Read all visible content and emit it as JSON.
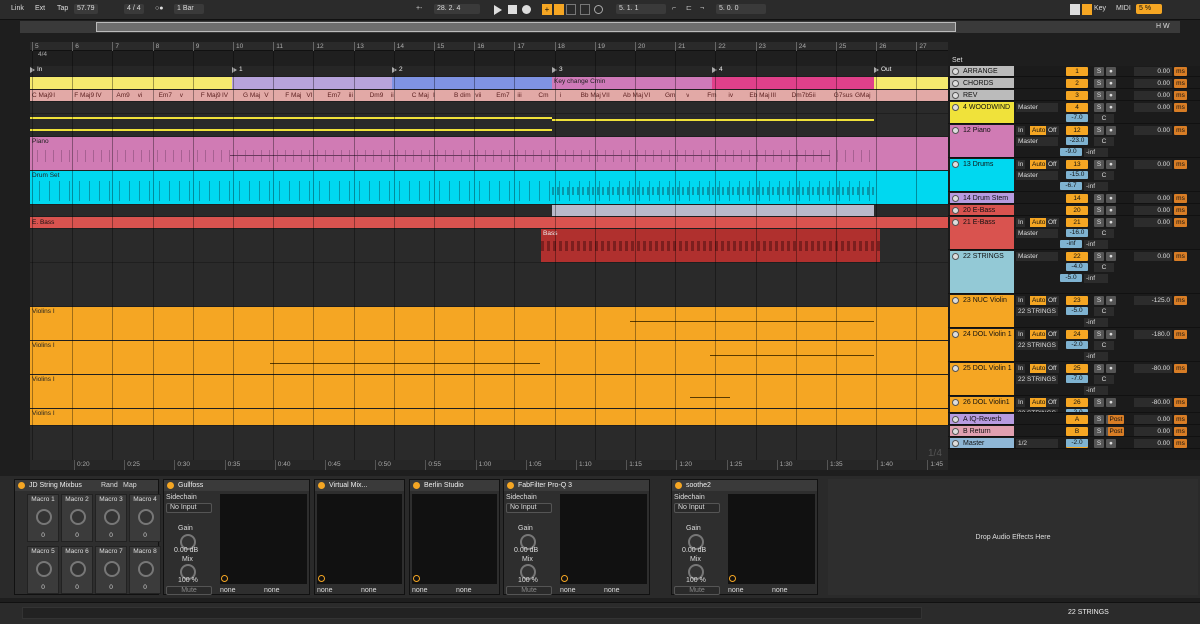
{
  "transport": {
    "link": "Link",
    "ext": "Ext",
    "tap": "Tap",
    "tempo": "57.79",
    "signature": "4 / 4",
    "loop_mode": "○●",
    "quantize": "1 Bar",
    "position": "28.   2.   4",
    "loop_start": "5.   1.   1",
    "loop_length": "5.   0.   0",
    "key": "Key",
    "midi": "MIDI",
    "cpu": "5 %"
  },
  "ruler": {
    "bars": [
      "5",
      "6",
      "7",
      "8",
      "9",
      "10",
      "11",
      "12",
      "13",
      "14",
      "15",
      "16",
      "17",
      "18",
      "19",
      "20",
      "21",
      "22",
      "23",
      "24",
      "25",
      "26",
      "27"
    ],
    "signature_marker": "4/4"
  },
  "locators": [
    {
      "label": "In"
    },
    {
      "label": "1"
    },
    {
      "label": "2"
    },
    {
      "label": "3"
    },
    {
      "label": "4"
    },
    {
      "label": "Out"
    }
  ],
  "chords": [
    "C Maj9",
    "I",
    "F Maj9",
    "IV",
    "Am9",
    "vi",
    "Em7",
    "v",
    "F Maj9",
    "IV",
    "G Maj",
    "V",
    "F Maj",
    "VI",
    "Em7",
    "iii",
    "Dm9",
    "ii",
    "C Maj",
    "I",
    "B dim",
    "vii",
    "Em7",
    "iii",
    "Cm",
    "i",
    "Bb Maj",
    "VII",
    "Ab Maj",
    "VI",
    "Gm",
    "v",
    "Fm",
    "iv",
    "Eb Maj",
    "III",
    "Dm7b5",
    "ii",
    "G7sus",
    "GMaj"
  ],
  "key_change": "Key change Cmin",
  "clips": {
    "piano": "Piano",
    "drums": "Drum Set",
    "ebass": "E. Bass",
    "bass": "Bass",
    "violins": "Violins I"
  },
  "tracks": [
    {
      "name": "ARRANGE",
      "num": "1",
      "val": "0.00"
    },
    {
      "name": "CHORDS",
      "num": "2",
      "val": "0.00"
    },
    {
      "name": "REV",
      "num": "3",
      "val": "0.00"
    },
    {
      "name": "4 WOODWIND",
      "num": "4",
      "io": "Master",
      "vol": "-7.0",
      "pan": "C",
      "val": "0.00"
    },
    {
      "name": "12 Piano",
      "num": "12",
      "in": "In",
      "auto": "Auto",
      "off": "Off",
      "io": "Master",
      "vol": "-23.0",
      "pan": "C",
      "vol2": "-9.0",
      "inf": "-inf",
      "val": "0.00"
    },
    {
      "name": "13 Drums",
      "num": "13",
      "in": "In",
      "auto": "Auto",
      "off": "Off",
      "io": "Master",
      "vol": "-15.0",
      "pan": "C",
      "vol2": "-6.7",
      "inf": "-inf",
      "val": "0.00"
    },
    {
      "name": "14 Drum Stem",
      "num": "14",
      "val": "0.00"
    },
    {
      "name": "20 E-Bass",
      "num": "20",
      "val": "0.00"
    },
    {
      "name": "21 E-Bass",
      "num": "21",
      "in": "In",
      "auto": "Auto",
      "off": "Off",
      "io": "Master",
      "vol": "-16.0",
      "pan": "C",
      "vol2": "-inf",
      "inf": "-inf",
      "val": "0.00"
    },
    {
      "name": "22 STRINGS",
      "num": "22",
      "io": "Master",
      "vol": "-4.0",
      "pan": "C",
      "vol2": "-5.0",
      "inf": "-inf",
      "val": "0.00"
    },
    {
      "name": "23 NUC Violin",
      "num": "23",
      "in": "In",
      "auto": "Auto",
      "off": "Off",
      "io": "22 STRINGS",
      "vol": "-5.0",
      "pan": "C",
      "inf": "-inf",
      "val": "-125.0"
    },
    {
      "name": "24 DOL Violin 1",
      "num": "24",
      "in": "In",
      "auto": "Auto",
      "off": "Off",
      "io": "22 STRINGS",
      "vol": "-2.0",
      "pan": "C",
      "inf": "-inf",
      "val": "-180.0"
    },
    {
      "name": "25 DOL Violin 1",
      "num": "25",
      "in": "In",
      "auto": "Auto",
      "off": "Off",
      "io": "22 STRINGS",
      "vol": "-7.0",
      "pan": "C",
      "inf": "-inf",
      "val": "-80.00"
    },
    {
      "name": "26 DOL Violin1",
      "num": "26",
      "in": "In",
      "auto": "Auto",
      "off": "Off",
      "io": "22 STRINGS",
      "vol": "-2.0",
      "val": "-80.00"
    },
    {
      "name": "A IQ-Reverb",
      "num": "A",
      "post": "Post",
      "val": "0.00"
    },
    {
      "name": "B Return",
      "num": "B",
      "post": "Post",
      "val": "0.00"
    },
    {
      "name": "Master",
      "num": "0",
      "io": "1/2",
      "vol": "-2.0",
      "val": "0.00"
    }
  ],
  "set_label": "Set",
  "timeline": [
    "0:20",
    "0:25",
    "0:30",
    "0:35",
    "0:40",
    "0:45",
    "0:50",
    "0:55",
    "1:00",
    "1:05",
    "1:10",
    "1:15",
    "1:20",
    "1:25",
    "1:30",
    "1:35",
    "1:40",
    "1:45"
  ],
  "zoom_label": "1/4",
  "devices": {
    "rack": {
      "title": "JD String Mixbus",
      "rand": "Rand",
      "map": "Map",
      "macros": [
        "Macro 1",
        "Macro 2",
        "Macro 3",
        "Macro 4",
        "Macro 5",
        "Macro 6",
        "Macro 7",
        "Macro 8"
      ],
      "macro_value": "0"
    },
    "plugins": [
      {
        "title": "Gullfoss",
        "sidechain": "Sidechain",
        "input": "No Input",
        "gain": "Gain",
        "gain_val": "0.00 dB",
        "mix": "Mix",
        "mix_val": "100 %",
        "mute": "Mute",
        "none1": "none",
        "none2": "none"
      },
      {
        "title": "Virtual Mix...",
        "none1": "none",
        "none2": "none"
      },
      {
        "title": "Berlin Studio",
        "none1": "none",
        "none2": "none"
      },
      {
        "title": "FabFilter Pro-Q 3",
        "sidechain": "Sidechain",
        "input": "No Input",
        "gain": "Gain",
        "gain_val": "0.00 dB",
        "mix": "Mix",
        "mix_val": "100 %",
        "mute": "Mute",
        "none1": "none",
        "none2": "none"
      },
      {
        "title": "soothe2",
        "sidechain": "Sidechain",
        "input": "No Input",
        "gain": "Gain",
        "gain_val": "0.00 dB",
        "mix": "Mix",
        "mix_val": "100 %",
        "mute": "Mute",
        "none1": "none",
        "none2": "none"
      }
    ],
    "drop_text": "Drop Audio Effects Here"
  },
  "status": {
    "selected_track": "22 STRINGS"
  },
  "colors": {
    "orange": "#f5a623",
    "pink": "#d07bb4",
    "cyan": "#00d8f0",
    "red": "#d9534f",
    "yellow": "#f0e23a",
    "purple": "#b79be0"
  }
}
